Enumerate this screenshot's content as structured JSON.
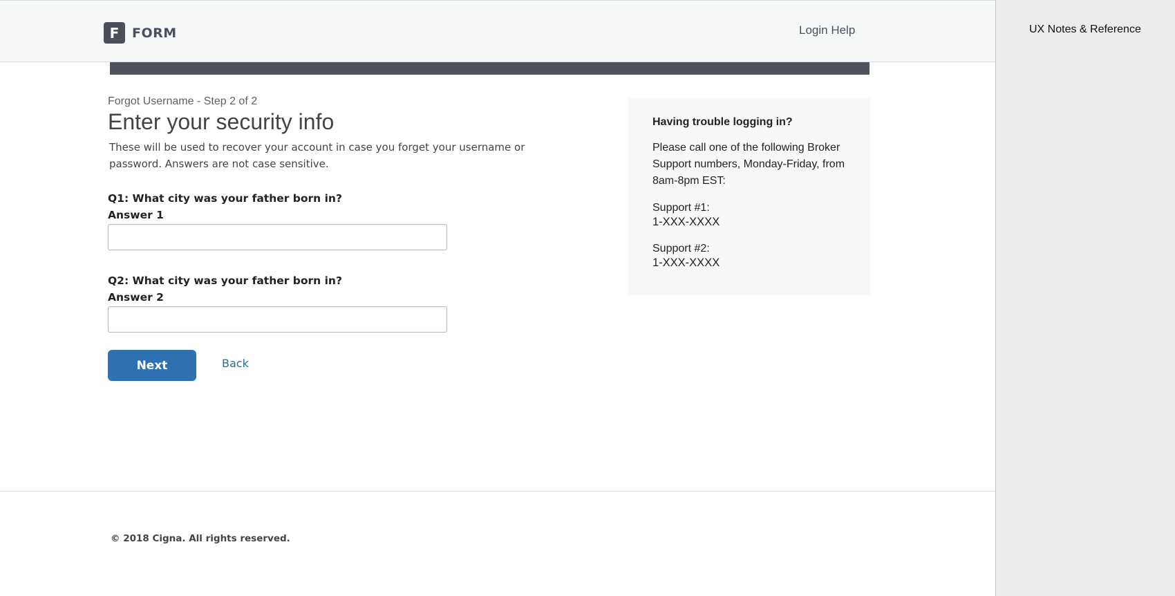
{
  "header": {
    "logo_letter": "F",
    "logo_text": "FORM",
    "login_help": "Login Help"
  },
  "form": {
    "step": "Forgot Username - Step 2 of 2",
    "title": "Enter your security info",
    "description": "These will be used to recover your account in case you forget your username or password. Answers are not case sensitive.",
    "q1_label": "Q1: What city was your father born in?",
    "answer1_label": "Answer 1",
    "answer1_value": "",
    "q2_label": "Q2: What city was your father born in?",
    "answer2_label": "Answer 2",
    "answer2_value": "",
    "next_label": "Next",
    "back_label": "Back"
  },
  "help": {
    "title": "Having trouble logging in?",
    "body": "Please call one of the following Broker Support numbers, Monday-Friday, from 8am-8pm EST:",
    "support1_label": "Support #1:",
    "support1_number": "1-XXX-XXXX",
    "support2_label": "Support #2:",
    "support2_number": "1-XXX-XXXX"
  },
  "footer": {
    "copyright": "© 2018 Cigna. All rights reserved."
  },
  "notes": {
    "title": "UX Notes & Reference"
  },
  "colors": {
    "primary_button": "#2f71b0",
    "header_bg": "#f6f8f8",
    "dark_bar": "#4f535e",
    "link": "#2f6d8e",
    "help_panel_bg": "#f8f8f8",
    "notes_bg": "#ececec"
  }
}
